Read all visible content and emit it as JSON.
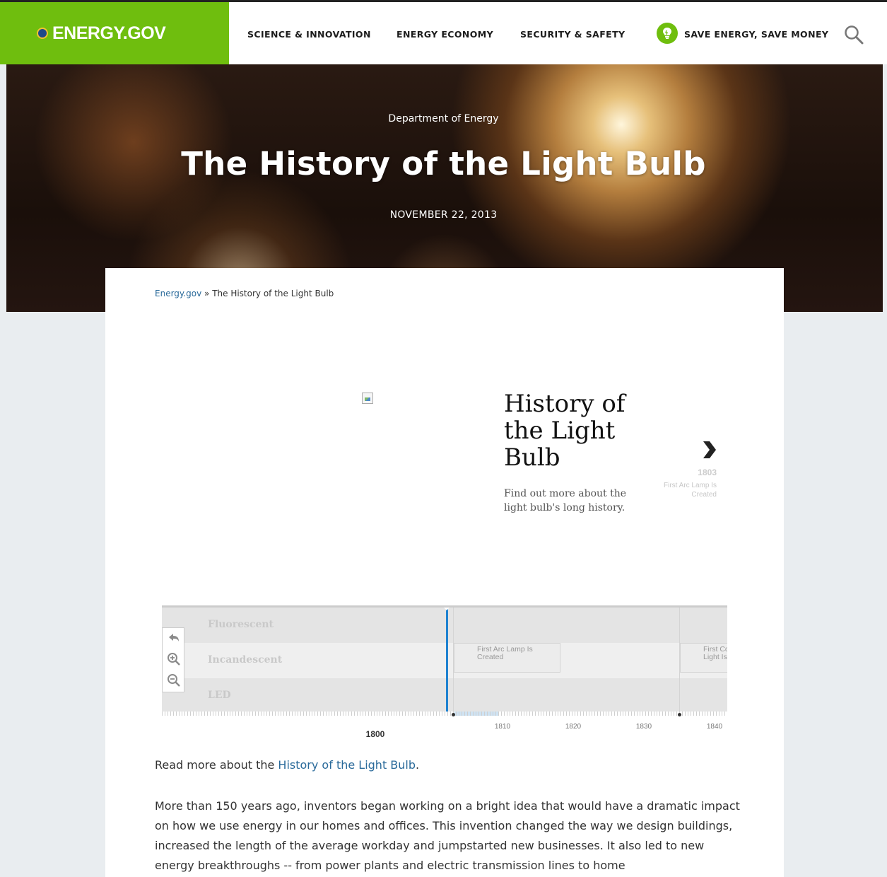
{
  "header": {
    "logo": "ENERGY.GOV",
    "nav": [
      "SCIENCE & INNOVATION",
      "ENERGY ECONOMY",
      "SECURITY & SAFETY",
      "SAVE ENERGY, SAVE MONEY"
    ]
  },
  "hero": {
    "kicker": "Department of Energy",
    "title": "The History of the Light Bulb",
    "date": "NOVEMBER 22, 2013"
  },
  "breadcrumb": {
    "home": "Energy.gov",
    "separator": "»",
    "current": "The History of the Light Bulb"
  },
  "timeline": {
    "title": "History of the Light Bulb",
    "description": "Find out more about the light bulb's long history.",
    "next_year": "1803",
    "next_event": "First Arc Lamp Is Created",
    "bands": [
      "Fluorescent",
      "Incandescent",
      "LED"
    ],
    "events": [
      "First Arc Lamp Is Created",
      "First Cons Light Is De"
    ],
    "axis_start": "1800",
    "axis_labels": [
      "1810",
      "1820",
      "1830",
      "1840"
    ]
  },
  "content": {
    "read_more_prefix": "Read more about the ",
    "read_more_link": "History of the Light Bulb",
    "read_more_suffix": ".",
    "paragraph": "More than 150 years ago, inventors began working on a bright idea that would have a dramatic impact on how we use energy in our homes and offices. This invention changed the way we design buildings, increased the length of the average workday and jumpstarted new businesses. It also led to new energy breakthroughs -- from power plants and electric transmission lines to home"
  },
  "colors": {
    "brand_green": "#6fbe0e",
    "link_blue": "#2a6a9a",
    "timeline_marker": "#1f82d0"
  }
}
